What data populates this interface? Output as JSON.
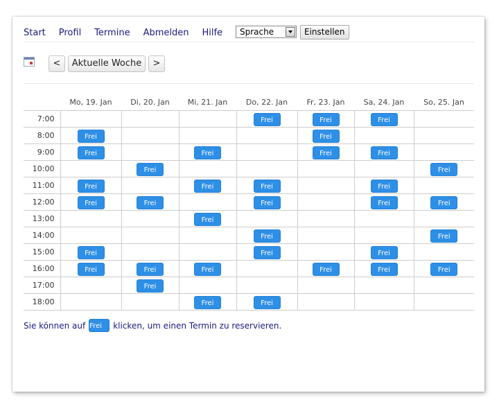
{
  "nav": {
    "items": [
      "Start",
      "Profil",
      "Termine",
      "Abmelden",
      "Hilfe"
    ],
    "language_select": "Sprache",
    "set_button": "Einstellen"
  },
  "week_nav": {
    "prev": "<",
    "current": "Aktuelle Woche",
    "next": ">"
  },
  "calendar": {
    "days": [
      "Mo, 19. Jan",
      "Di, 20. Jan",
      "Mi, 21. Jan",
      "Do, 22. Jan",
      "Fr, 23. Jan",
      "Sa, 24. Jan",
      "So, 25. Jan"
    ],
    "slot_label": "Frei",
    "rows": [
      {
        "time": "7:00",
        "free": [
          false,
          false,
          false,
          true,
          true,
          true,
          false
        ]
      },
      {
        "time": "8:00",
        "free": [
          true,
          false,
          false,
          false,
          true,
          false,
          false
        ]
      },
      {
        "time": "9:00",
        "free": [
          true,
          false,
          true,
          false,
          true,
          true,
          false
        ]
      },
      {
        "time": "10:00",
        "free": [
          false,
          true,
          false,
          false,
          false,
          false,
          true
        ]
      },
      {
        "time": "11:00",
        "free": [
          true,
          false,
          true,
          true,
          false,
          true,
          false
        ]
      },
      {
        "time": "12:00",
        "free": [
          true,
          true,
          false,
          true,
          false,
          true,
          true
        ]
      },
      {
        "time": "13:00",
        "free": [
          false,
          false,
          true,
          false,
          false,
          false,
          false
        ]
      },
      {
        "time": "14:00",
        "free": [
          false,
          false,
          false,
          true,
          false,
          false,
          true
        ]
      },
      {
        "time": "15:00",
        "free": [
          true,
          false,
          false,
          true,
          false,
          true,
          false
        ]
      },
      {
        "time": "16:00",
        "free": [
          true,
          true,
          true,
          false,
          true,
          true,
          true
        ]
      },
      {
        "time": "17:00",
        "free": [
          false,
          true,
          false,
          false,
          false,
          false,
          false
        ]
      },
      {
        "time": "18:00",
        "free": [
          false,
          false,
          true,
          true,
          false,
          false,
          false
        ]
      }
    ]
  },
  "hint": {
    "before": "Sie können auf",
    "badge": "Frei",
    "after": "klicken, um einen Termin zu reservieren."
  },
  "colors": {
    "slot": "#2e8fe6",
    "link": "#1a1a80"
  }
}
